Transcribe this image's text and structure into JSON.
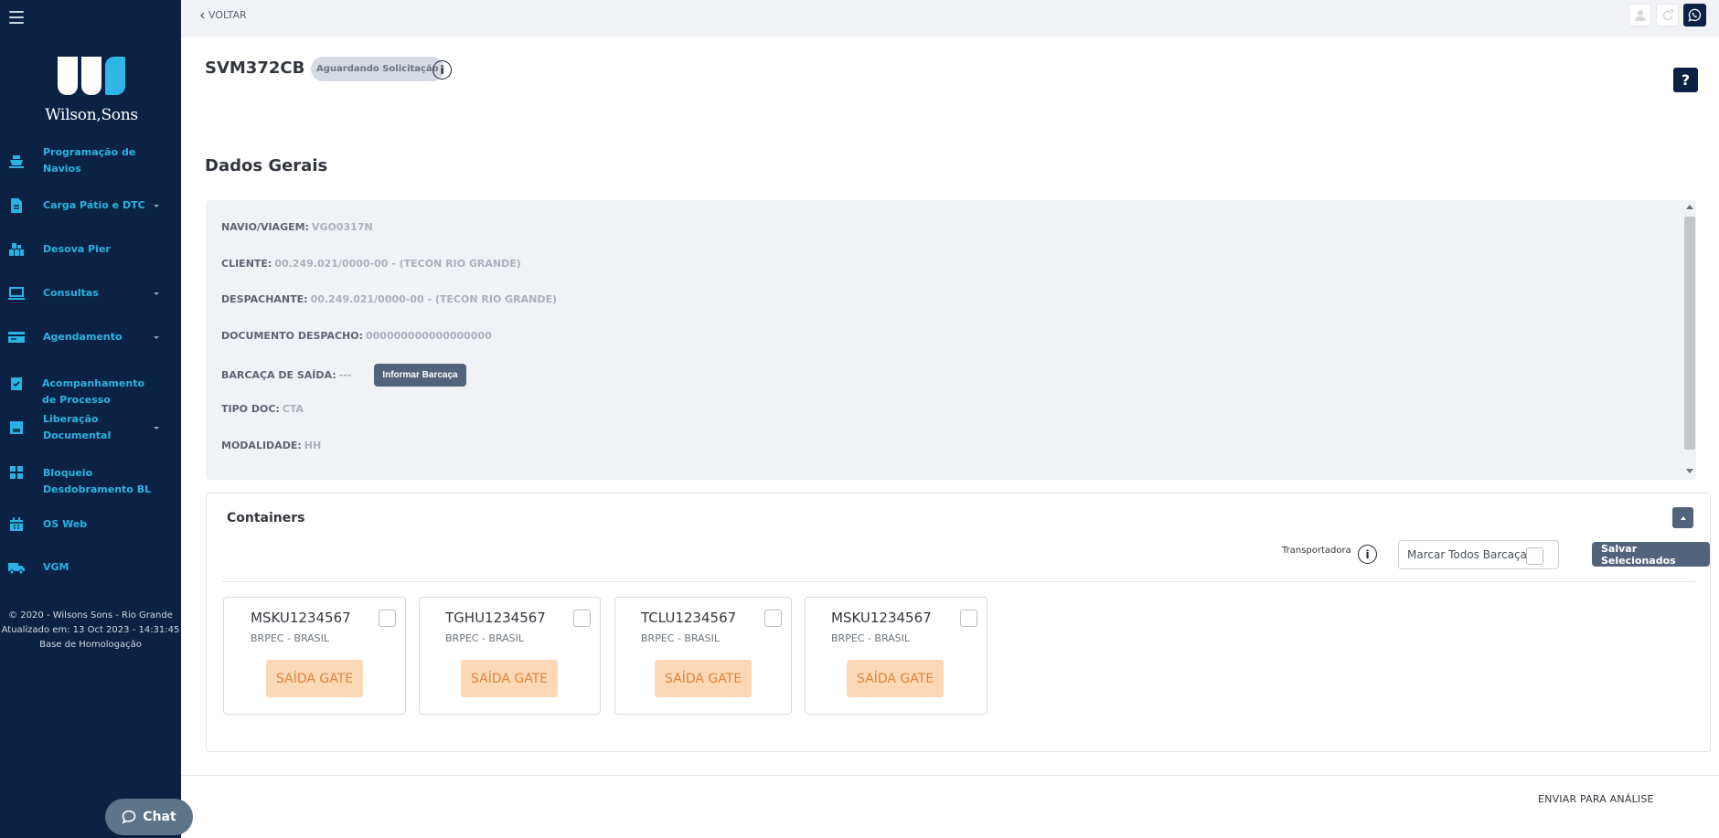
{
  "topbar": {
    "back_label": "VOLTAR"
  },
  "header": {
    "title": "SVM372CB",
    "status": "Aguardando Solicitação",
    "help_label": "?"
  },
  "brand": {
    "name": "Wilson,Sons"
  },
  "sidebar": {
    "items": [
      {
        "label": "Programação de Navios",
        "icon": "ship-icon",
        "has_submenu": false
      },
      {
        "label": "Carga Pátio e DTC",
        "icon": "document-icon",
        "has_submenu": true
      },
      {
        "label": "Desova Pier",
        "icon": "boxes-icon",
        "has_submenu": false
      },
      {
        "label": "Consultas",
        "icon": "monitor-icon",
        "has_submenu": true
      },
      {
        "label": "Agendamento",
        "icon": "card-icon",
        "has_submenu": true
      },
      {
        "label": "Acompanhamento de Processo",
        "icon": "clipboard-check-icon",
        "has_submenu": false
      },
      {
        "label": "Liberação Documental",
        "icon": "file-icon",
        "has_submenu": true
      },
      {
        "label": "Bloqueio Desdobramento BL",
        "icon": "grid-icon",
        "has_submenu": false
      },
      {
        "label": "OS Web",
        "icon": "calendar-icon",
        "has_submenu": false
      },
      {
        "label": "VGM",
        "icon": "truck-icon",
        "has_submenu": false
      }
    ],
    "footer": {
      "copyright": "© 2020 - Wilsons Sons - Rio Grande",
      "updated": "Atualizado em: 13 Oct 2023 - 14:31:45",
      "environment": "Base de Homologação"
    },
    "chat_label": "Chat"
  },
  "general": {
    "title": "Dados Gerais",
    "fields": {
      "navio": {
        "label": "NAVIO/VIAGEM:",
        "value": "VGO0317N"
      },
      "cliente": {
        "label": "CLIENTE:",
        "value": "00.249.021/0000-00 - (TECON RIO GRANDE)"
      },
      "despachante": {
        "label": "DESPACHANTE:",
        "value": "00.249.021/0000-00 - (TECON RIO GRANDE)"
      },
      "documento": {
        "label": "DOCUMENTO DESPACHO:",
        "value": "000000000000000000"
      },
      "barcaca": {
        "label": "BARCAÇA DE SAÍDA:",
        "value": "---"
      },
      "tipo": {
        "label": "TIPO DOC:",
        "value": "CTA"
      },
      "modalidade": {
        "label": "MODALIDADE:",
        "value": "HH"
      }
    },
    "inform_barcaca_label": "Informar Barcaça"
  },
  "containers": {
    "title": "Containers",
    "transportadora_label": "Transportadora",
    "mark_all_label": "Marcar Todos Barcaça",
    "save_label": "Salvar Selecionados",
    "items": [
      {
        "id": "MSKU1234567",
        "location": "BRPEC - BRASIL",
        "action": "SAÍDA GATE",
        "checked": false
      },
      {
        "id": "TGHU1234567",
        "location": "BRPEC - BRASIL",
        "action": "SAÍDA GATE",
        "checked": false
      },
      {
        "id": "TCLU1234567",
        "location": "BRPEC - BRASIL",
        "action": "SAÍDA GATE",
        "checked": false
      },
      {
        "id": "MSKU1234567",
        "location": "BRPEC - BRASIL",
        "action": "SAÍDA GATE",
        "checked": false
      }
    ]
  },
  "footer": {
    "submit_label": "ENVIAR PARA ANÁLISE"
  },
  "colors": {
    "sidebar_bg": "#0c2244",
    "nav_accent": "#2ab3e2",
    "button_dark": "#52647c",
    "action_bg": "#fdd8b6",
    "action_text": "#e0843f"
  }
}
